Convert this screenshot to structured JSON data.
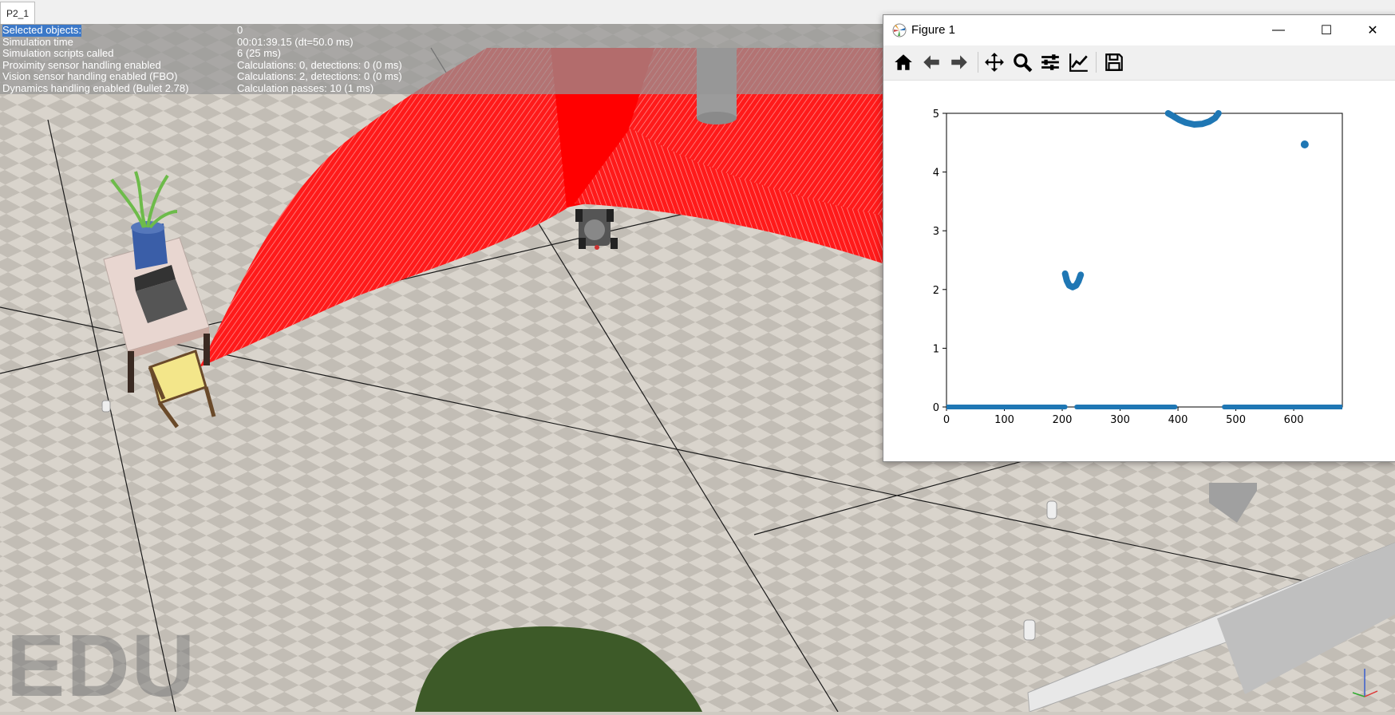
{
  "app": {
    "tab_label": "P2_1"
  },
  "info_panel": [
    {
      "label": "Selected objects:",
      "value": "0"
    },
    {
      "label": "Simulation time",
      "value": "00:01:39.15 (dt=50.0 ms)"
    },
    {
      "label": "Simulation scripts called",
      "value": "6 (25 ms)"
    },
    {
      "label": "Proximity sensor handling enabled",
      "value": "Calculations: 0, detections: 0 (0 ms)"
    },
    {
      "label": "Vision sensor handling enabled (FBO)",
      "value": "Calculations: 2, detections: 0 (0 ms)"
    },
    {
      "label": "Dynamics handling enabled (Bullet 2.78)",
      "value": "Calculation passes: 10 (1 ms)"
    }
  ],
  "watermark": "EDU",
  "figure": {
    "title": "Figure 1",
    "window_buttons": {
      "minimize": "—",
      "maximize": "☐",
      "close": "✕"
    },
    "toolbar": [
      "home-icon",
      "back-icon",
      "forward-icon",
      "pan-icon",
      "zoom-icon",
      "configure-subplots-icon",
      "edit-axis-icon",
      "save-icon"
    ]
  },
  "chart_data": {
    "type": "scatter",
    "title": "",
    "xlabel": "",
    "ylabel": "",
    "xlim": [
      0,
      684
    ],
    "ylim": [
      0,
      5
    ],
    "xticks": [
      0,
      100,
      200,
      300,
      400,
      500,
      600
    ],
    "yticks": [
      0,
      1,
      2,
      3,
      4,
      5
    ],
    "grid": false,
    "color": "#1f77b4",
    "segments": [
      {
        "x_from": 0,
        "x_to": 205,
        "y": 0
      },
      {
        "x_from": 225,
        "x_to": 395,
        "y": 0
      },
      {
        "x_from": 480,
        "x_to": 684,
        "y": 0
      }
    ],
    "curves": [
      {
        "points": [
          [
            205,
            2.27
          ],
          [
            208,
            2.15
          ],
          [
            212,
            2.07
          ],
          [
            218,
            2.04
          ],
          [
            224,
            2.07
          ],
          [
            228,
            2.14
          ],
          [
            232,
            2.25
          ]
        ]
      },
      {
        "points": [
          [
            383,
            5.0
          ],
          [
            392,
            4.95
          ],
          [
            402,
            4.89
          ],
          [
            414,
            4.84
          ],
          [
            428,
            4.81
          ],
          [
            442,
            4.82
          ],
          [
            454,
            4.86
          ],
          [
            464,
            4.92
          ],
          [
            470,
            5.0
          ]
        ]
      }
    ],
    "points": [
      [
        619,
        4.47
      ]
    ]
  }
}
